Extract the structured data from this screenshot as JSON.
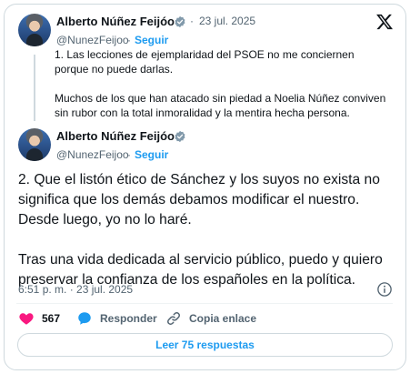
{
  "quoted_post": {
    "author_name": "Alberto Núñez Feijóo",
    "separator": "·",
    "date": "23 jul. 2025",
    "handle": "@NunezFeijoo",
    "handle_separator": "·",
    "follow_label": "Seguir",
    "paragraphs": [
      "1. Las lecciones de ejemplaridad del PSOE no me conciernen porque no puede darlas.",
      "Muchos de los que han atacado sin piedad a Noelia Núñez conviven sin rubor con la total inmoralidad y la mentira hecha persona."
    ]
  },
  "main_post": {
    "author_name": "Alberto Núñez Feijóo",
    "handle": "@NunezFeijoo",
    "handle_separator": "·",
    "follow_label": "Seguir",
    "paragraphs": [
      "2. Que el listón ético de Sánchez y los suyos no exista no significa que los demás debamos modificar el nuestro. Desde luego, yo no lo haré.",
      "Tras una vida dedicada al servicio público, puedo y quiero preservar la confianza de los españoles en la política."
    ],
    "timestamp": "6:51 p. m. · 23 jul. 2025"
  },
  "actions": {
    "likes_count": "567",
    "reply_label": "Responder",
    "copy_link_label": "Copia enlace"
  },
  "read_replies_label": "Leer 75 respuestas",
  "icons": {
    "logo": "x-logo-icon",
    "verified": "verified-badge-icon",
    "like": "heart-icon",
    "reply": "reply-bubble-icon",
    "copy_link": "link-icon",
    "info": "info-icon"
  },
  "colors": {
    "accent": "#1d9bf0",
    "like": "#f91880",
    "verified_badge": "#829aab",
    "secondary_text": "#536471",
    "border": "#cfd9de"
  }
}
